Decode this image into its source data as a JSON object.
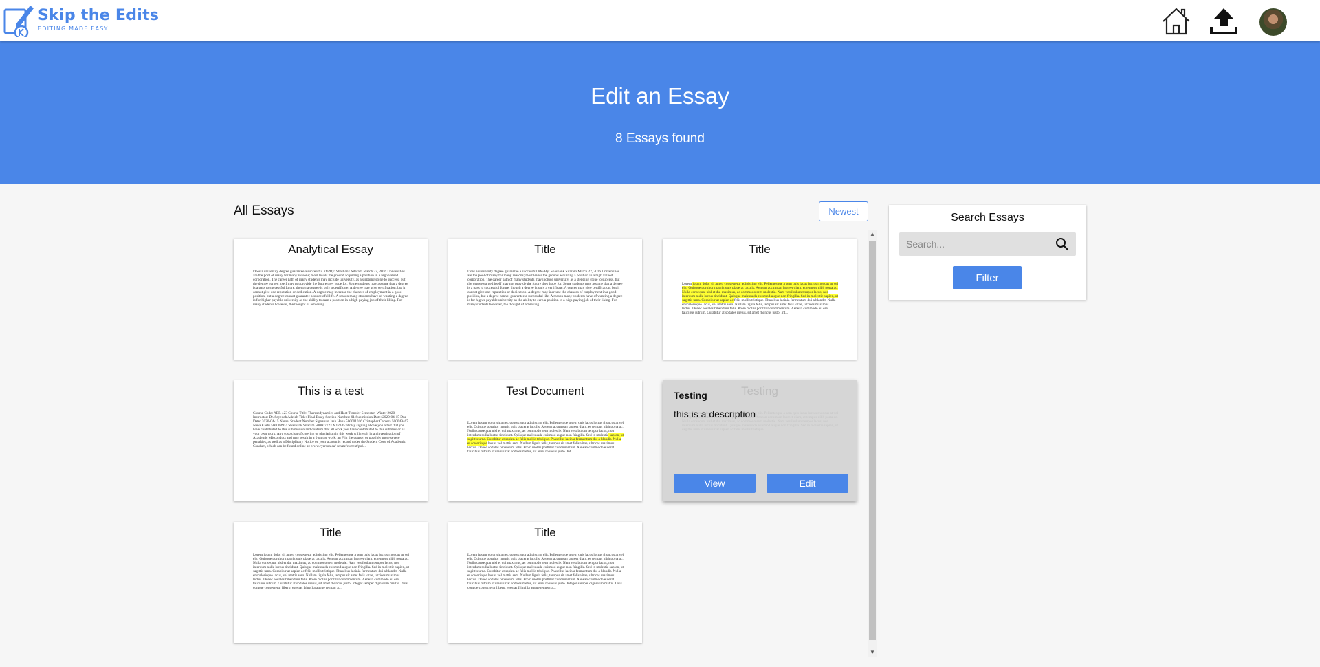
{
  "header": {
    "brand_name": "Skip the Edits",
    "brand_tagline": "EDITING MADE EASY",
    "nav": {
      "home_icon": "home-icon",
      "upload_icon": "upload-icon",
      "avatar": "user-avatar"
    }
  },
  "hero": {
    "title": "Edit an Essay",
    "subtitle": "8 Essays found"
  },
  "list": {
    "heading": "All Essays",
    "sort_label": "Newest"
  },
  "essays": [
    {
      "title": "Analytical Essay",
      "preview": "Does a university degree guarantee a successful life?By: Shashank Sitaram March 22, 2016 Universities are the pool of many for many reasons; most levels the ground acquiring a position in a high valued corporation. The career path of many students may include university, as a stepping stone to success, but the degree earned itself may not provide the future they hope for. Some students may assume that a degree is a pass to successful future, though a degree is only a certificate. A degree may give certification, but it cannot give one reputation or dedication. A degree may increase the chances of employment in a good position, but a degree cannot guarantee a successful life. A reason many students have of wanting a degree is for higher payable university as the ability to earn a position in a high-paying job of their liking. For many students however, the thought of achieving ..."
    },
    {
      "title": "Title",
      "preview": "Does a university degree guarantee a successful life?By: Shashank Sitaram March 22, 2016 Universities are the pool of many for many reasons; most levels the ground acquiring a position in a high valued corporation. The career path of many students may include university, as a stepping stone to success, but the degree earned itself may not provide the future they hope for. Some students may assume that a degree is a pass to successful future, though a degree is only a certificate. A degree may give certification, but it cannot give one reputation or dedication. A degree may increase the chances of employment in a good position, but a degree cannot guarantee a successful life. A reason many students have of wanting a degree is for higher payable university as the ability to earn a position in a high-paying job of their liking. For many students however, the thought of achieving ..."
    },
    {
      "title": "Title",
      "preview_pre": "Lorem ",
      "preview_hl": "ipsum dolor sit amet, consectetur adipiscing elit. Pellentesque a sem quis lacus luctus rhoncus at vel elit. Quisque porttitor mauris quis placerat iaculis. Aenean accumsan laoreet diam, et tempus nibh porta ac. Nulla consequat nisl et dui maximus, ac commodo sem molestie. Nam vestibulum tempor lacus, non interdum nulla luctus tincidunt. Quisque malesuada euismod augue non fringilla. Sed in molestie sapien, ut sagittis urna. Curabitur at sapien ac",
      "preview_post": " felis mollis tristique. Phasellus lacinia fermentum dui a blandit. Nulla et scelerisque lacus, vel mattis sem. Nullam ligula felis, tempus sit amet felis vitae, ultrices maximus lectus. Donec sodales bibendum felis. Proin mollis porttitor condimentum. Aenean commodo eu erat faucibus rutrum. Curabitur at sodales metus, sit amet rhoncus justo. Int..."
    },
    {
      "title": "This is a test",
      "preview": "Course Code: AER 423 Course Title: Thermodynamics and Heat Transfer Semester: Winter 2020 Instructor: Dr. Seyedeh Adeleh Title: Final Essay Section Number: 01 Submission Date: 2020-04-15 Due Date: 2020-04-15 Name: Student Number Signature Jash Hana 500001016 Cristopher Cervera 500049467 Nena Kashi 500008914 Shashank Sitaram 500007723 A 12345782 By signing above you attest that you have contributed to this submission and confirm that all work you have contributed to this submission is your own work. Any suspicion of copying or plagiarism in this work will result in an investigation of Academic Misconduct and may result in a 0 on the work, an F in the course, or possibly more severe penalties, as well as a Disciplinary Notice on your academic record under the Student Code of Academic Conduct, which can be found online at: www.ryerson.ca/ senate/current/pol..."
    },
    {
      "title": "Test Document",
      "preview_pre": "Lorem ipsum dolor sit amet, consectetur adipiscing elit. Pellentesque a sem quis lacus luctus rhoncus at vel elit. Quisque porttitor mauris quis placerat iaculis. Aenean accumsan laoreet diam, et tempus nibh porta ac. Nulla consequat nisl et dui maximus, ac commodo sem molestie. Nam vestibulum tempor lacus, non interdum nulla luctus tincidunt. Quisque malesuada euismod augue non fringilla. Sed in molestie",
      "preview_hl": " sapien, ut sagittis urna. Curabitur at sapien ac felis mollis tristique. Phasellus lacinia fermentum dui a blandit. Nulla et scelerisque",
      "preview_post": " lacus, vel mattis sem. Nullam ligula felis, tempus sit amet felis vitae, ultrices maximus lectus. Donec sodales bibendum felis. Proin mollis porttitor condimentum. Aenean commodo eu erat faucibus rutrum. Curabitur at sodales metus, sit amet rhoncus justo. Int..."
    },
    {
      "title": "Testing",
      "preview": "Lorem ipsum dolor sit amet, consectetur adipiscing elit. Pellentesque a sem quis lacus luctus rhoncus at vel elit. Quisque porttitor mauris quis placerat iaculis. Aenean accumsan laoreet diam, et tempus nibh porta ac. Nulla consequat nisl et dui maximus, ac commodo sem molestie. Nam vestibulum tempor lacus, non interdum nulla luctus tincidunt. Quisque malesuada euismod augue non fringilla. Sed in molestie sapien, ut sagittis urna. Curabitur at sapien ac felis mollis tristique.",
      "hover": {
        "title": "Testing",
        "description": "this is a description",
        "view_label": "View",
        "edit_label": "Edit"
      }
    },
    {
      "title": "Title",
      "preview": "Lorem ipsum dolor sit amet, consectetur adipiscing elit. Pellentesque a sem quis lacus luctus rhoncus at vel elit. Quisque porttitor mauris quis placerat iaculis. Aenean accumsan laoreet diam, et tempus nibh porta ac. Nulla consequat nisl et dui maximus, ac commodo sem molestie. Nam vestibulum tempor lacus, non interdum nulla luctus tincidunt. Quisque malesuada euismod augue non fringilla. Sed in molestie sapien, ut sagittis urna. Curabitur at sapien ac felis mollis tristique. Phasellus lacinia fermentum dui a blandit. Nulla et scelerisque lacus, vel mattis sem. Nullam ligula felis, tempus sit amet felis vitae, ultrices maximus lectus. Donec sodales bibendum felis. Proin mollis porttitor condimentum. Aenean commodo eu erat faucibus rutrum. Curabitur at sodales metus, sit amet rhoncus justo. Integer semper dignissim mattis. Duis congue consectetur libero, egestas fringilla augue tempor a..."
    },
    {
      "title": "Title",
      "preview": "Lorem ipsum dolor sit amet, consectetur adipiscing elit. Pellentesque a sem quis lacus luctus rhoncus at vel elit. Quisque porttitor mauris quis placerat iaculis. Aenean accumsan laoreet diam, et tempus nibh porta ac. Nulla consequat nisl et dui maximus, ac commodo sem molestie. Nam vestibulum tempor lacus, non interdum nulla luctus tincidunt. Quisque malesuada euismod augue non fringilla. Sed in molestie sapien, ut sagittis urna. Curabitur at sapien ac felis mollis tristique. Phasellus lacinia fermentum dui a blandit. Nulla et scelerisque lacus, vel mattis sem. Nullam ligula felis, tempus sit amet felis vitae, ultrices maximus lectus. Donec sodales bibendum felis. Proin mollis porttitor condimentum. Aenean commodo eu erat faucibus rutrum. Curabitur at sodales metus, sit amet rhoncus justo. Integer semper dignissim mattis. Duis congue consectetur libero, egestas fringilla augue tempor a..."
    }
  ],
  "search": {
    "title": "Search Essays",
    "placeholder": "Search...",
    "filter_label": "Filter"
  },
  "colors": {
    "accent": "#4a86e8",
    "highlight": "#ffff33",
    "background": "#f6f6f6"
  }
}
